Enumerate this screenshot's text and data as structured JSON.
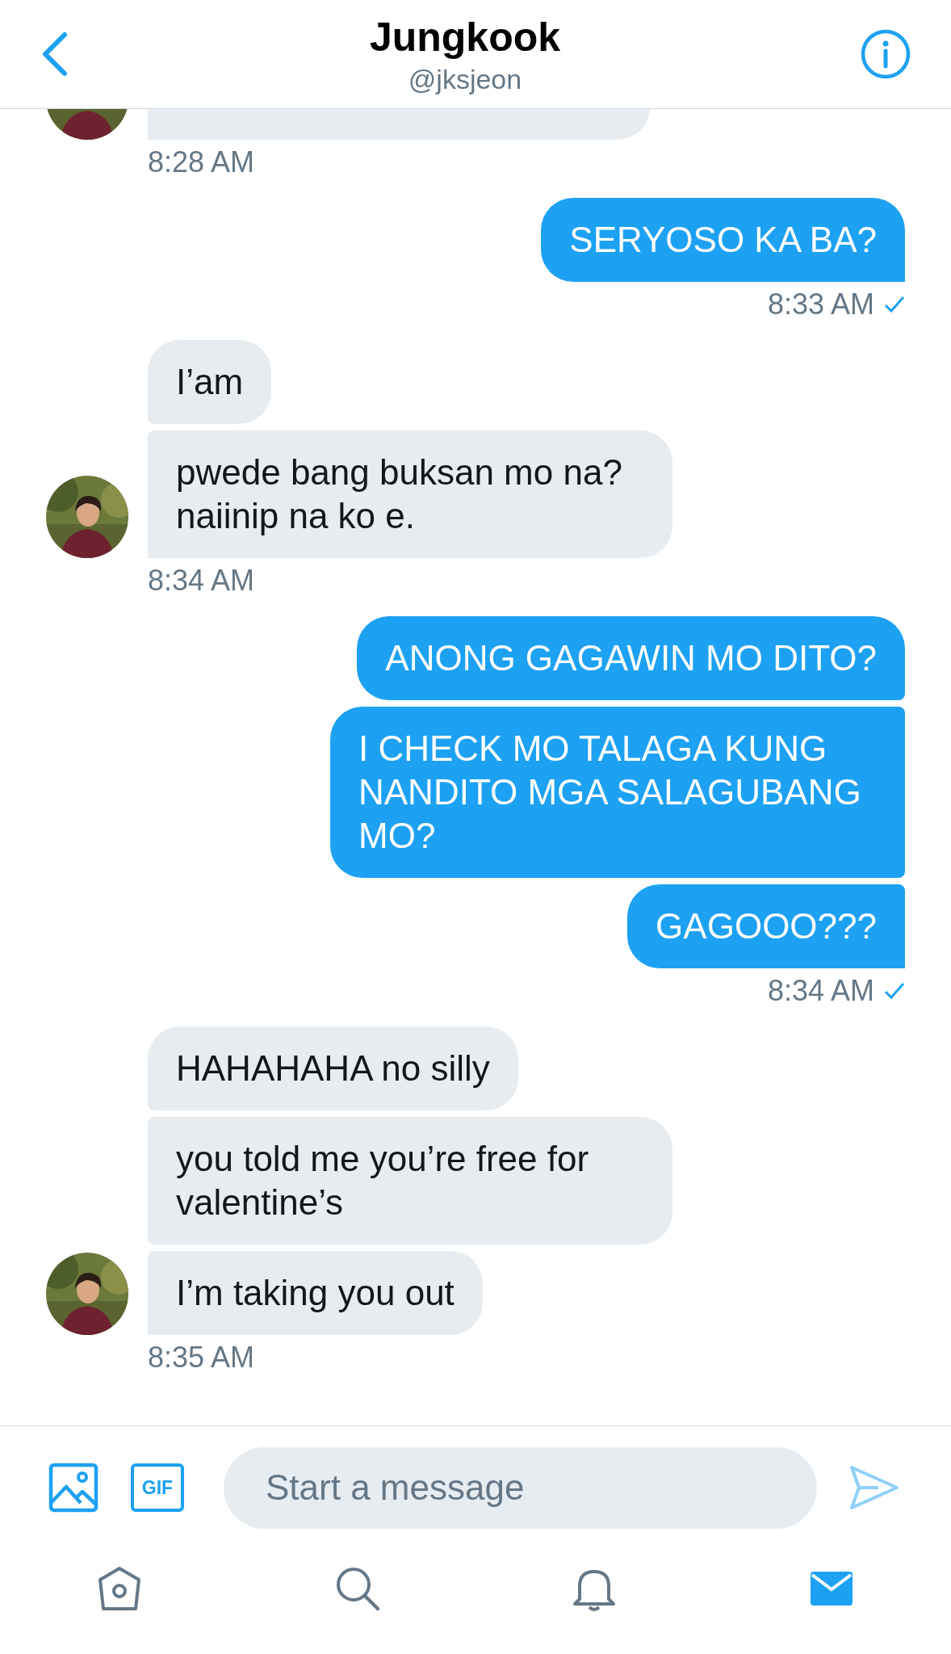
{
  "header": {
    "title": "Jungkook",
    "handle": "@jksjeon"
  },
  "groups": [
    {
      "kind": "incoming_cut",
      "time": "8:28 AM"
    },
    {
      "kind": "outgoing",
      "bubbles": [
        "SERYOSO KA BA?"
      ],
      "time": "8:33 AM",
      "read": true
    },
    {
      "kind": "incoming",
      "bubbles": [
        "I’am",
        "pwede bang buksan mo na? naiinip na ko e."
      ],
      "time": "8:34 AM"
    },
    {
      "kind": "outgoing",
      "bubbles": [
        "ANONG GAGAWIN MO DITO?",
        "I CHECK MO TALAGA KUNG NANDITO MGA SALAGUBANG MO?",
        "GAGOOO???"
      ],
      "time": "8:34 AM",
      "read": true
    },
    {
      "kind": "incoming",
      "bubbles": [
        "HAHAHAHA no silly",
        "you told me you’re free for valentine’s",
        "I’m taking you out"
      ],
      "time": "8:35 AM"
    }
  ],
  "composer": {
    "gif_label": "GIF",
    "placeholder": "Start a message"
  },
  "tabs": [
    {
      "kind": "home",
      "selected": false
    },
    {
      "kind": "search",
      "selected": false
    },
    {
      "kind": "notifications",
      "selected": false
    },
    {
      "kind": "messages",
      "selected": true
    }
  ]
}
